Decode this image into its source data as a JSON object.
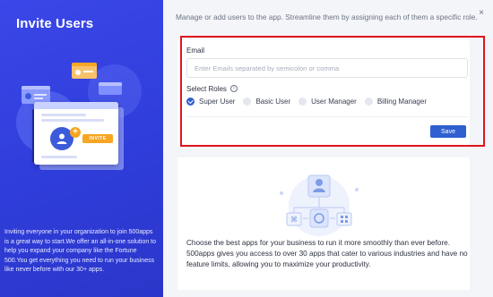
{
  "left_panel": {
    "title": "Invite Users",
    "description": "Inviting everyone in your organization to join 500apps is a great way to start.We offer an all-in-one solution to help you expand your company like the Fortune 500.You get everything you need to run your business like never before with our 30+ apps.",
    "illustration": {
      "invite_badge": "INVITE",
      "plus": "+"
    }
  },
  "header": {
    "subtitle": "Manage or add users to the app. Streamline them by assigning each of them a specific role.",
    "close": "×"
  },
  "form": {
    "email_label": "Email",
    "email_placeholder": "Enter Emails separated by semicolon or comma",
    "email_value": "",
    "roles_label": "Select Roles",
    "roles_info_icon": "i",
    "roles": [
      {
        "label": "Super User",
        "checked": true
      },
      {
        "label": "Basic User",
        "checked": false
      },
      {
        "label": "User Manager",
        "checked": false
      },
      {
        "label": "Billing Manager",
        "checked": false
      }
    ],
    "save_label": "Save"
  },
  "apps_section": {
    "description": "Choose the best apps for your business to run it more smoothly than ever before. 500apps gives you access to over 30 apps that cater to various industries and have no feature limits, allowing you to maximize your productivity."
  },
  "colors": {
    "left_bg": "#3040dc",
    "accent": "#2f5fd0",
    "highlight": "#e0141e",
    "invite_orange": "#f6a623"
  }
}
